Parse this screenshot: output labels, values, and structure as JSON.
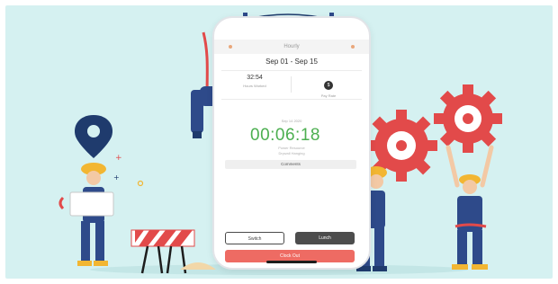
{
  "app": {
    "header_title": "Hourly",
    "date_range": "Sep 01 - Sep 15",
    "hours_worked_value": "32:54",
    "hours_worked_label": "Hours Worked",
    "pay_badge": "$",
    "pay_label": "Pay Rate",
    "entry_date": "Sep 14 2020",
    "timer": "00:06:18",
    "task_line_1": "Power Resource",
    "task_line_2": "Drywall Hanging",
    "comments_label": "Comments",
    "switch_label": "Switch",
    "lunch_label": "Lunch",
    "clock_out_label": "Clock Out"
  },
  "colors": {
    "background": "#d5f1f1",
    "timer_green": "#4caf50",
    "clock_out": "#ee6b63",
    "gear_red": "#e24a4a",
    "worker_blue": "#2e4a8a",
    "hardhat_yellow": "#f2b632",
    "location_pin": "#1f3b6d"
  },
  "illustration": {
    "elements": [
      "location-pin-icon",
      "gear-icon",
      "construction-barrier-icon",
      "worker-figure",
      "hard-hat-icon"
    ]
  }
}
